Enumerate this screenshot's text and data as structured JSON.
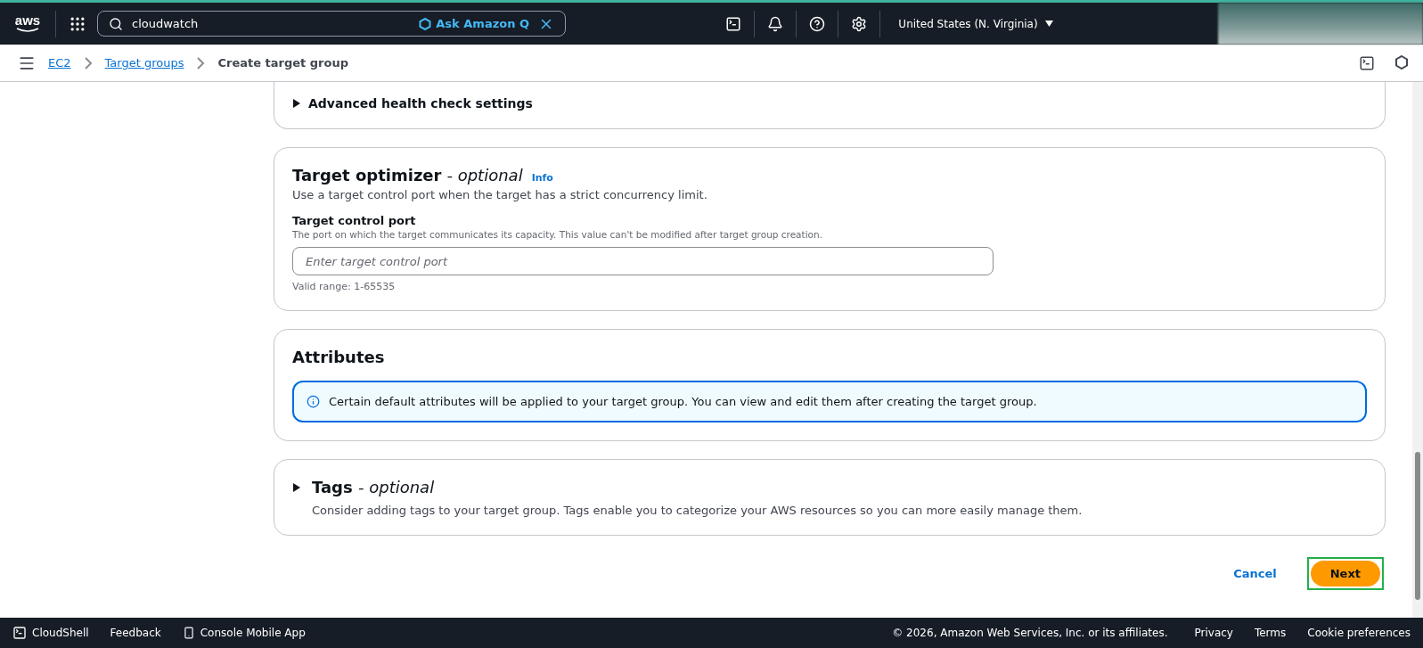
{
  "top_bar": {
    "logo": "aws",
    "search": {
      "value": "cloudwatch"
    },
    "ask_q": "Ask Amazon Q",
    "region": "United States (N. Virginia)"
  },
  "breadcrumbs": [
    {
      "label": "EC2",
      "link": true
    },
    {
      "label": "Target groups",
      "link": true
    },
    {
      "label": "Create target group",
      "link": false
    }
  ],
  "sections": [
    {
      "kind": "collapsed",
      "title": "Advanced health check settings",
      "expanded": false
    },
    {
      "kind": "optimizer",
      "title": "Target optimizer",
      "optional": "- optional",
      "info": "Info",
      "description": "Use a target control port when the target has a strict concurrency limit.",
      "field_label": "Target control port",
      "field_hint": "The port on which the target communicates its capacity. This value can't be modified after target group creation.",
      "placeholder": "Enter target control port",
      "constraint": "Valid range: 1-65535"
    },
    {
      "kind": "attributes",
      "title": "Attributes",
      "alert": "Certain default attributes will be applied to your target group. You can view and edit them after creating the target group."
    },
    {
      "kind": "tags",
      "title": "Tags",
      "optional": "- optional",
      "description": "Consider adding tags to your target group. Tags enable you to categorize your AWS resources so you can more easily manage them.",
      "expanded": false
    }
  ],
  "actions": {
    "cancel": "Cancel",
    "next": "Next"
  },
  "footer": {
    "left": [
      "CloudShell",
      "Feedback",
      "Console Mobile App"
    ],
    "copyright": "© 2026, Amazon Web Services, Inc. or its affiliates.",
    "links": [
      "Privacy",
      "Terms",
      "Cookie preferences"
    ]
  }
}
